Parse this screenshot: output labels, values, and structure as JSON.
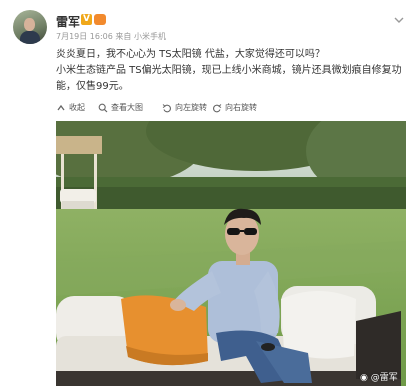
{
  "post": {
    "author": "雷军",
    "verified_badge": "V",
    "time": "7月19日 16:06",
    "source_prefix": "来自",
    "source": "小米手机",
    "text_line1": "炎炎夏日，我不心心为 TS太阳镜 代盐，大家觉得还可以吗？",
    "text_line2": "小米生态链产品 TS偏光太阳镜，现已上线小米商城，镜片还具微划痕自修复功",
    "text_line3": "能，仅售99元。"
  },
  "toolbar": {
    "collapse": "收起",
    "view_large": "查看大图",
    "rotate_left": "向左旋转",
    "rotate_right": "向右旋转"
  },
  "watermark": "@雷军",
  "colors": {
    "accent_link": "#eb7350",
    "verified": "#f0a81a",
    "grass": "#7fa05a"
  },
  "icons": [
    "chevron-down-icon",
    "crown-icon",
    "collapse-icon",
    "zoom-icon",
    "rotate-left-icon",
    "rotate-right-icon",
    "weibo-icon"
  ]
}
